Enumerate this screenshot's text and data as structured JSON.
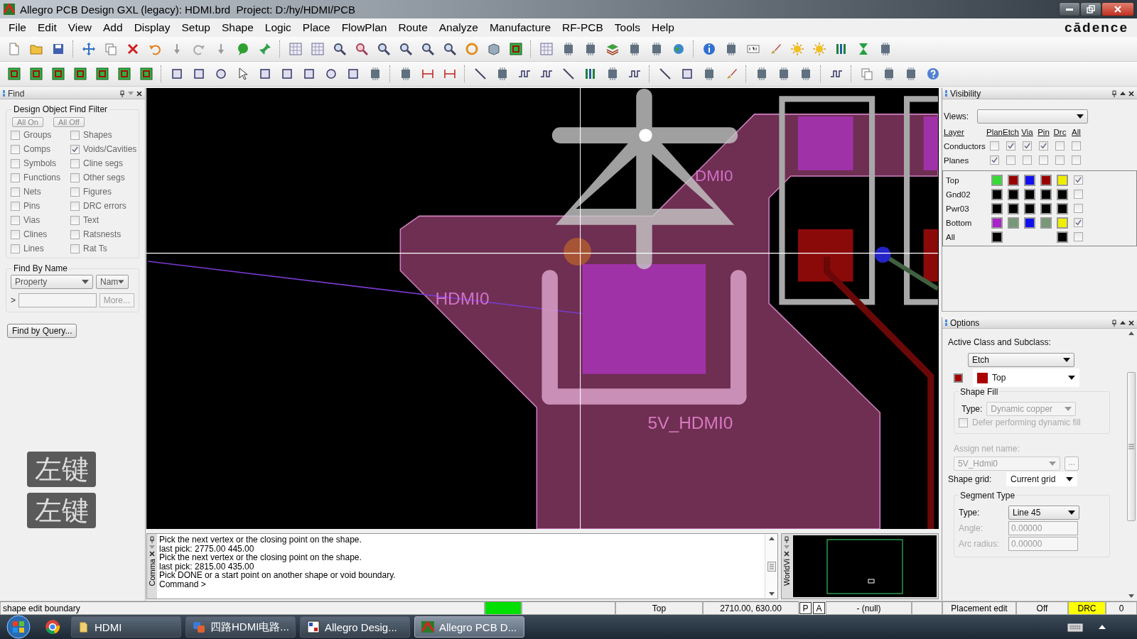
{
  "window": {
    "title": "Allegro PCB Design GXL (legacy): HDMI.brd  Project: D:/hy/HDMI/PCB"
  },
  "menu": [
    "File",
    "Edit",
    "View",
    "Add",
    "Display",
    "Setup",
    "Shape",
    "Logic",
    "Place",
    "FlowPlan",
    "Route",
    "Analyze",
    "Manufacture",
    "RF-PCB",
    "Tools",
    "Help"
  ],
  "brand": "cādence",
  "find": {
    "title": "Find",
    "filter_title": "Design Object Find Filter",
    "buttons": [
      "All On",
      "All Off"
    ],
    "filters": [
      {
        "label": "Groups",
        "checked": false
      },
      {
        "label": "Shapes",
        "checked": false
      },
      {
        "label": "Comps",
        "checked": false
      },
      {
        "label": "Voids/Cavities",
        "checked": true
      },
      {
        "label": "Symbols",
        "checked": false
      },
      {
        "label": "Cline segs",
        "checked": false
      },
      {
        "label": "Functions",
        "checked": false
      },
      {
        "label": "Other segs",
        "checked": false
      },
      {
        "label": "Nets",
        "checked": false
      },
      {
        "label": "Figures",
        "checked": false
      },
      {
        "label": "Pins",
        "checked": false
      },
      {
        "label": "DRC errors",
        "checked": false
      },
      {
        "label": "Vias",
        "checked": false
      },
      {
        "label": "Text",
        "checked": false
      },
      {
        "label": "Clines",
        "checked": false
      },
      {
        "label": "Ratsnests",
        "checked": false
      },
      {
        "label": "Lines",
        "checked": false
      },
      {
        "label": "Rat Ts",
        "checked": false
      }
    ],
    "by_name": {
      "title": "Find By Name",
      "property": "Property",
      "name": "Nam",
      "prompt": ">",
      "more": "More..."
    },
    "query_button": "Find by Query..."
  },
  "key_overlays": [
    "左键",
    "左键"
  ],
  "canvas": {
    "labels": [
      {
        "text": "DMI0"
      },
      {
        "text": "HDMI0"
      },
      {
        "text": "5V_HDMI0"
      }
    ]
  },
  "command": {
    "tab": "Comma",
    "lines": [
      "Pick the next vertex or the closing point on the shape.",
      "last pick:  2775.00 445.00",
      "Pick the next vertex or the closing point on the shape.",
      "last pick:  2815.00 435.00",
      "Pick DONE or a start point on another shape or void boundary.",
      "Command >"
    ]
  },
  "worldview": {
    "tab": "WorldVi"
  },
  "visibility": {
    "title": "Visibility",
    "views_label": "Views:",
    "columns": [
      "Layer",
      "Plan",
      "Etch",
      "Via",
      "Pin",
      "Drc",
      "All"
    ],
    "groups": [
      {
        "label": "Conductors",
        "checks": [
          false,
          true,
          true,
          true,
          false,
          false
        ]
      },
      {
        "label": "Planes",
        "checks": [
          true,
          false,
          false,
          false,
          false,
          false
        ]
      }
    ],
    "layers": [
      {
        "label": "Top",
        "swatches": [
          {
            "kind": "swatch",
            "color": "#33dd33"
          },
          {
            "kind": "swatch",
            "color": "#990000"
          },
          {
            "kind": "swatch",
            "color": "#1010ee"
          },
          {
            "kind": "swatch",
            "color": "#990000"
          },
          {
            "kind": "swatch",
            "color": "#eeee00"
          }
        ],
        "all": true
      },
      {
        "label": "Gnd02",
        "swatches": [
          {
            "kind": "swatch",
            "color": "#000000"
          },
          {
            "kind": "swatch",
            "color": "#000000"
          },
          {
            "kind": "swatch",
            "color": "#000000"
          },
          {
            "kind": "swatch",
            "color": "#000000"
          },
          {
            "kind": "swatch",
            "color": "#000000"
          }
        ],
        "all": false
      },
      {
        "label": "Pwr03",
        "swatches": [
          {
            "kind": "swatch",
            "color": "#000000"
          },
          {
            "kind": "swatch",
            "color": "#000000"
          },
          {
            "kind": "swatch",
            "color": "#000000"
          },
          {
            "kind": "swatch",
            "color": "#000000"
          },
          {
            "kind": "swatch",
            "color": "#000000"
          }
        ],
        "all": false
      },
      {
        "label": "Bottom",
        "swatches": [
          {
            "kind": "swatch",
            "color": "#aa22cc"
          },
          {
            "kind": "swatch",
            "color": "#779977"
          },
          {
            "kind": "swatch",
            "color": "#1010ee"
          },
          {
            "kind": "swatch",
            "color": "#779977"
          },
          {
            "kind": "swatch",
            "color": "#eeee00"
          }
        ],
        "all": true
      },
      {
        "label": "All",
        "swatches": [
          {
            "kind": "swatch",
            "color": "#000000"
          },
          {
            "kind": "empty"
          },
          {
            "kind": "empty"
          },
          {
            "kind": "empty"
          },
          {
            "kind": "swatch",
            "color": "#000000"
          }
        ],
        "all": false
      }
    ]
  },
  "options": {
    "title": "Options",
    "active_label": "Active Class and Subclass:",
    "class": "Etch",
    "subclass": {
      "label": "Top",
      "color": "#aa0000"
    },
    "shape_fill": {
      "title": "Shape Fill",
      "type_label": "Type:",
      "type": "Dynamic copper",
      "disabled": true,
      "defer": {
        "label": "Defer performing dynamic fill",
        "checked": false
      }
    },
    "net": {
      "label": "Assign net name:",
      "value": "5V_Hdmi0",
      "button": "...",
      "disabled": true
    },
    "grid": {
      "label": "Shape grid:",
      "value": "Current grid"
    },
    "segment": {
      "title": "Segment Type",
      "type_label": "Type:",
      "type": "Line 45",
      "angle_label": "Angle:",
      "angle": "0.00000",
      "arc_label": "Arc radius:",
      "arc": "0.00000",
      "disabled": true
    }
  },
  "status_bar": [
    {
      "text": "shape edit boundary"
    },
    {
      "kind": "indicator",
      "color": "#00e000"
    },
    {
      "kind": "blank"
    },
    {
      "text": "Top"
    },
    {
      "text": "2710.00, 630.00"
    },
    {
      "text": "P",
      "kind": "toggle"
    },
    {
      "text": "A",
      "kind": "toggle"
    },
    {
      "text": "- (null)"
    },
    {
      "kind": "blank"
    },
    {
      "text": "Placement edit"
    },
    {
      "text": "Off"
    },
    {
      "text": "DRC",
      "color": "#ffff00"
    },
    {
      "text": "0"
    }
  ],
  "taskbar": {
    "tasks": [
      {
        "label": "HDMI",
        "kind": "folder",
        "selected": false
      },
      {
        "label": "四路HDMI电路...",
        "kind": "slides",
        "selected": false
      },
      {
        "label": "Allegro Desig...",
        "kind": "viewer",
        "selected": false
      },
      {
        "label": "Allegro PCB D...",
        "kind": "pcb",
        "selected": true
      }
    ]
  }
}
